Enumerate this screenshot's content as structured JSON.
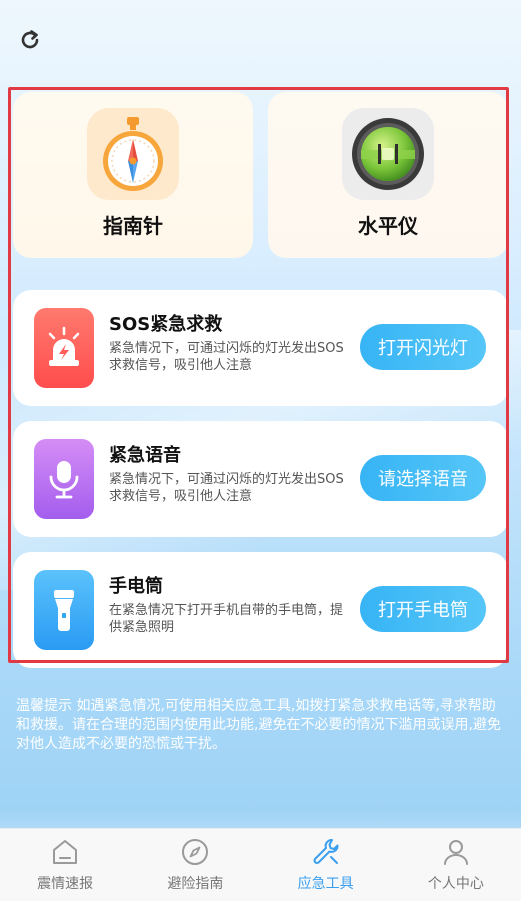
{
  "topbar": {
    "refresh_icon": "refresh-icon"
  },
  "tools_top": [
    {
      "label": "指南针",
      "icon": "compass-icon"
    },
    {
      "label": "水平仪",
      "icon": "level-icon"
    }
  ],
  "tools_rows": [
    {
      "title": "SOS紧急求救",
      "desc": "紧急情况下，可通过闪烁的灯光发出SOS求救信号，吸引他人注意",
      "button": "打开闪光灯",
      "icon": "alarm-light-icon",
      "color": "#ff5c5c"
    },
    {
      "title": "紧急语音",
      "desc": "紧急情况下，可通过闪烁的灯光发出SOS求救信号，吸引他人注意",
      "button": "请选择语音",
      "icon": "microphone-icon",
      "color": "#b56cf0"
    },
    {
      "title": "手电筒",
      "desc": "在紧急情况下打开手机自带的手电筒，提供紧急照明",
      "button": "打开手电筒",
      "icon": "flashlight-icon",
      "color": "#2ea6f7"
    }
  ],
  "tip": "温馨提示 如遇紧急情况,可使用相关应急工具,如拨打紧急求救电话等,寻求帮助和救援。请在合理的范围内使用此功能,避免在不必要的情况下滥用或误用,避免对他人造成不必要的恐慌或干扰。",
  "tabs": [
    {
      "label": "震情速报",
      "icon": "house-icon",
      "active": false
    },
    {
      "label": "避险指南",
      "icon": "compass-outline-icon",
      "active": false
    },
    {
      "label": "应急工具",
      "icon": "wrench-icon",
      "active": true
    },
    {
      "label": "个人中心",
      "icon": "person-icon",
      "active": false
    }
  ],
  "colors": {
    "accent": "#3b9ff0",
    "highlight_frame": "#e23a45"
  }
}
